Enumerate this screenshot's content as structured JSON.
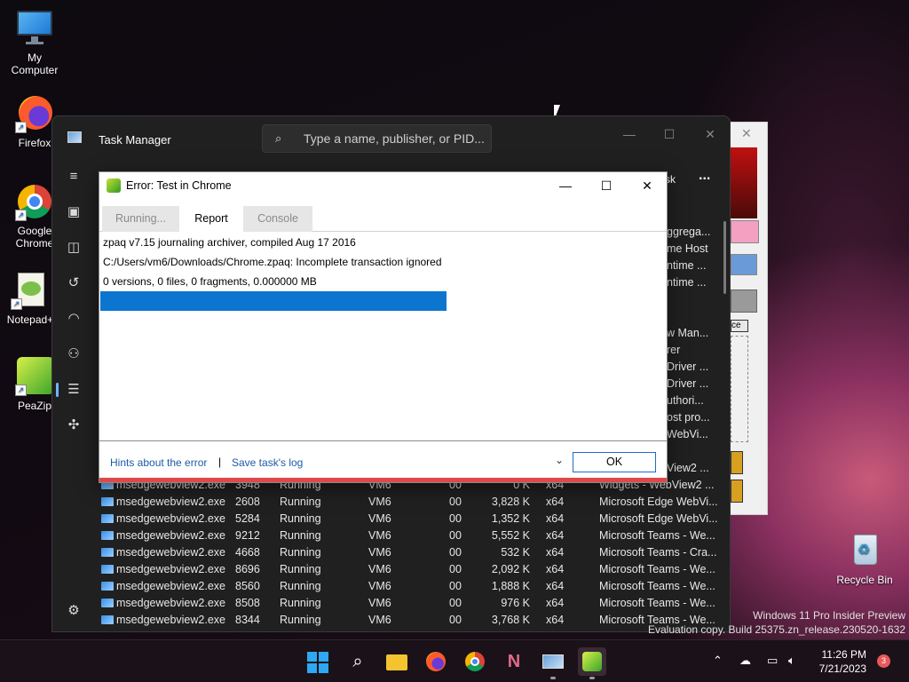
{
  "desktop": {
    "icons": [
      {
        "label": "My Computer"
      },
      {
        "label": "Firefox"
      },
      {
        "label": "Google Chrome"
      },
      {
        "label": "Notepad+"
      },
      {
        "label": "PeaZip"
      },
      {
        "label": "Recycle Bin"
      }
    ],
    "watermark": {
      "line1": "Windows 11 Pro Insider Preview",
      "line2": "Evaluation copy. Build 25375.zn_release.230520-1632"
    }
  },
  "task_manager": {
    "title": "Task Manager",
    "search_placeholder": "Type a name, publisher, or PID...",
    "toolbar_more": "...",
    "toolbar_partial": "sk",
    "background_descriptions": [
      "ggrega...",
      "me Host",
      "ntime ...",
      "ntime ...",
      "w Man...",
      "rer",
      "Driver ...",
      "Driver ...",
      "uthori...",
      "ost pro...",
      "WebVi...",
      "View2 ..."
    ],
    "rows": [
      {
        "name": "msedgewebview2.exe",
        "pid": "3948",
        "status": "Running",
        "user": "VM6",
        "cpu": "00",
        "memory": "0 K",
        "arch": "x64",
        "description": "Widgets - WebView2 ..."
      },
      {
        "name": "msedgewebview2.exe",
        "pid": "2608",
        "status": "Running",
        "user": "VM6",
        "cpu": "00",
        "memory": "3,828 K",
        "arch": "x64",
        "description": "Microsoft Edge WebVi..."
      },
      {
        "name": "msedgewebview2.exe",
        "pid": "5284",
        "status": "Running",
        "user": "VM6",
        "cpu": "00",
        "memory": "1,352 K",
        "arch": "x64",
        "description": "Microsoft Edge WebVi..."
      },
      {
        "name": "msedgewebview2.exe",
        "pid": "9212",
        "status": "Running",
        "user": "VM6",
        "cpu": "00",
        "memory": "5,552 K",
        "arch": "x64",
        "description": "Microsoft Teams - We..."
      },
      {
        "name": "msedgewebview2.exe",
        "pid": "4668",
        "status": "Running",
        "user": "VM6",
        "cpu": "00",
        "memory": "532 K",
        "arch": "x64",
        "description": "Microsoft Teams - Cra..."
      },
      {
        "name": "msedgewebview2.exe",
        "pid": "8696",
        "status": "Running",
        "user": "VM6",
        "cpu": "00",
        "memory": "2,092 K",
        "arch": "x64",
        "description": "Microsoft Teams - We..."
      },
      {
        "name": "msedgewebview2.exe",
        "pid": "8560",
        "status": "Running",
        "user": "VM6",
        "cpu": "00",
        "memory": "1,888 K",
        "arch": "x64",
        "description": "Microsoft Teams - We..."
      },
      {
        "name": "msedgewebview2.exe",
        "pid": "8508",
        "status": "Running",
        "user": "VM6",
        "cpu": "00",
        "memory": "976 K",
        "arch": "x64",
        "description": "Microsoft Teams - We..."
      },
      {
        "name": "msedgewebview2.exe",
        "pid": "8344",
        "status": "Running",
        "user": "VM6",
        "cpu": "00",
        "memory": "3,768 K",
        "arch": "x64",
        "description": "Microsoft Teams - We..."
      }
    ]
  },
  "error_dialog": {
    "title": "Error: Test  in Chrome",
    "tabs": [
      {
        "label": "Running...",
        "active": false
      },
      {
        "label": "Report",
        "active": true
      },
      {
        "label": "Console",
        "active": false
      }
    ],
    "lines": [
      "zpaq v7.15 journaling archiver, compiled Aug 17 2016",
      "C:/Users/vm6/Downloads/Chrome.zpaq: Incomplete transaction ignored",
      "0 versions, 0 files, 0 fragments, 0.000000 MB"
    ],
    "progress_fraction": 0.61,
    "hints_link": "Hints about the error",
    "separator": "|",
    "save_log_link": "Save task's log",
    "ok_label": "OK",
    "accent_color": "#0b75d0"
  },
  "behind_window": {
    "partial_label": "ce"
  },
  "taskbar": {
    "apps": [
      "start-icon",
      "search-icon",
      "file-explorer-icon",
      "firefox-icon",
      "chrome-icon",
      "app-icon",
      "task-manager-icon",
      "peazip-icon"
    ],
    "clock_time": "11:26 PM",
    "clock_date": "7/21/2023",
    "notification_count": "3"
  }
}
